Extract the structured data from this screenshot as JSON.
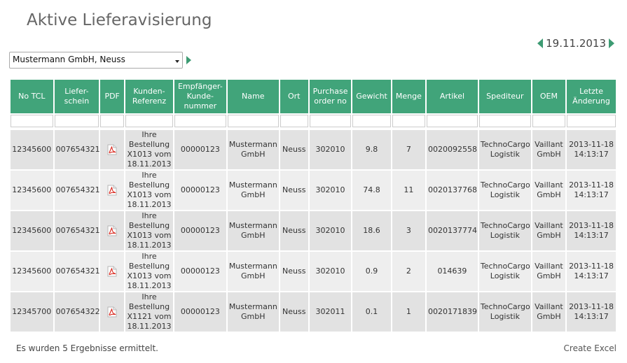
{
  "header": {
    "title": "Aktive Lieferavisierung",
    "date": "19.11.2013"
  },
  "supplier_select": {
    "selected": "Mustermann GmbH, Neuss"
  },
  "table": {
    "columns": [
      "No TCL",
      "Liefer-\nschein",
      "PDF",
      "Kunden-\nReferenz",
      "Empfänger-\nKunde-\nnummer",
      "Name",
      "Ort",
      "Purchase\norder no",
      "Gewicht",
      "Menge",
      "Artikel",
      "Spediteur",
      "OEM",
      "Letzte\nÄnderung"
    ],
    "rows": [
      {
        "no_tcl": "12345600",
        "lieferschein": "007654321",
        "kunden_referenz": "Ihre Bestellung X1013 vom 18.11.2013",
        "empfaenger_nr": "00000123",
        "name": "Mustermann GmbH",
        "ort": "Neuss",
        "purchase_order": "302010",
        "gewicht": "9.8",
        "menge": "7",
        "artikel": "0020092558",
        "spediteur": "TechnoCargo Logistik",
        "oem": "Vaillant GmbH",
        "letzte_aenderung": "2013-11-18 14:13:17"
      },
      {
        "no_tcl": "12345600",
        "lieferschein": "007654321",
        "kunden_referenz": "Ihre Bestellung X1013 vom 18.11.2013",
        "empfaenger_nr": "00000123",
        "name": "Mustermann GmbH",
        "ort": "Neuss",
        "purchase_order": "302010",
        "gewicht": "74.8",
        "menge": "11",
        "artikel": "0020137768",
        "spediteur": "TechnoCargo Logistik",
        "oem": "Vaillant GmbH",
        "letzte_aenderung": "2013-11-18 14:13:17"
      },
      {
        "no_tcl": "12345600",
        "lieferschein": "007654321",
        "kunden_referenz": "Ihre Bestellung X1013 vom 18.11.2013",
        "empfaenger_nr": "00000123",
        "name": "Mustermann GmbH",
        "ort": "Neuss",
        "purchase_order": "302010",
        "gewicht": "18.6",
        "menge": "3",
        "artikel": "0020137774",
        "spediteur": "TechnoCargo Logistik",
        "oem": "Vaillant GmbH",
        "letzte_aenderung": "2013-11-18 14:13:17"
      },
      {
        "no_tcl": "12345600",
        "lieferschein": "007654321",
        "kunden_referenz": "Ihre Bestellung X1013 vom 18.11.2013",
        "empfaenger_nr": "00000123",
        "name": "Mustermann GmbH",
        "ort": "Neuss",
        "purchase_order": "302010",
        "gewicht": "0.9",
        "menge": "2",
        "artikel": "014639",
        "spediteur": "TechnoCargo Logistik",
        "oem": "Vaillant GmbH",
        "letzte_aenderung": "2013-11-18 14:13:17"
      },
      {
        "no_tcl": "12345700",
        "lieferschein": "007654322",
        "kunden_referenz": "Ihre Bestellung X1121 vom 18.11.2013",
        "empfaenger_nr": "00000123",
        "name": "Mustermann GmbH",
        "ort": "Neuss",
        "purchase_order": "302011",
        "gewicht": "0.1",
        "menge": "1",
        "artikel": "0020171839",
        "spediteur": "TechnoCargo Logistik",
        "oem": "Vaillant GmbH",
        "letzte_aenderung": "2013-11-18 14:13:17"
      }
    ]
  },
  "footer": {
    "result_count": "Es wurden 5 Ergebnisse ermittelt.",
    "excel_link": "Create Excel"
  },
  "icons": {
    "pdf": "pdf-icon",
    "date_prev": "triangle-left-icon",
    "date_next": "triangle-right-icon",
    "select_go": "triangle-right-icon"
  },
  "colors": {
    "accent": "#41a47a",
    "arrow": "#3d9b73",
    "pdf_red": "#d9261c"
  }
}
